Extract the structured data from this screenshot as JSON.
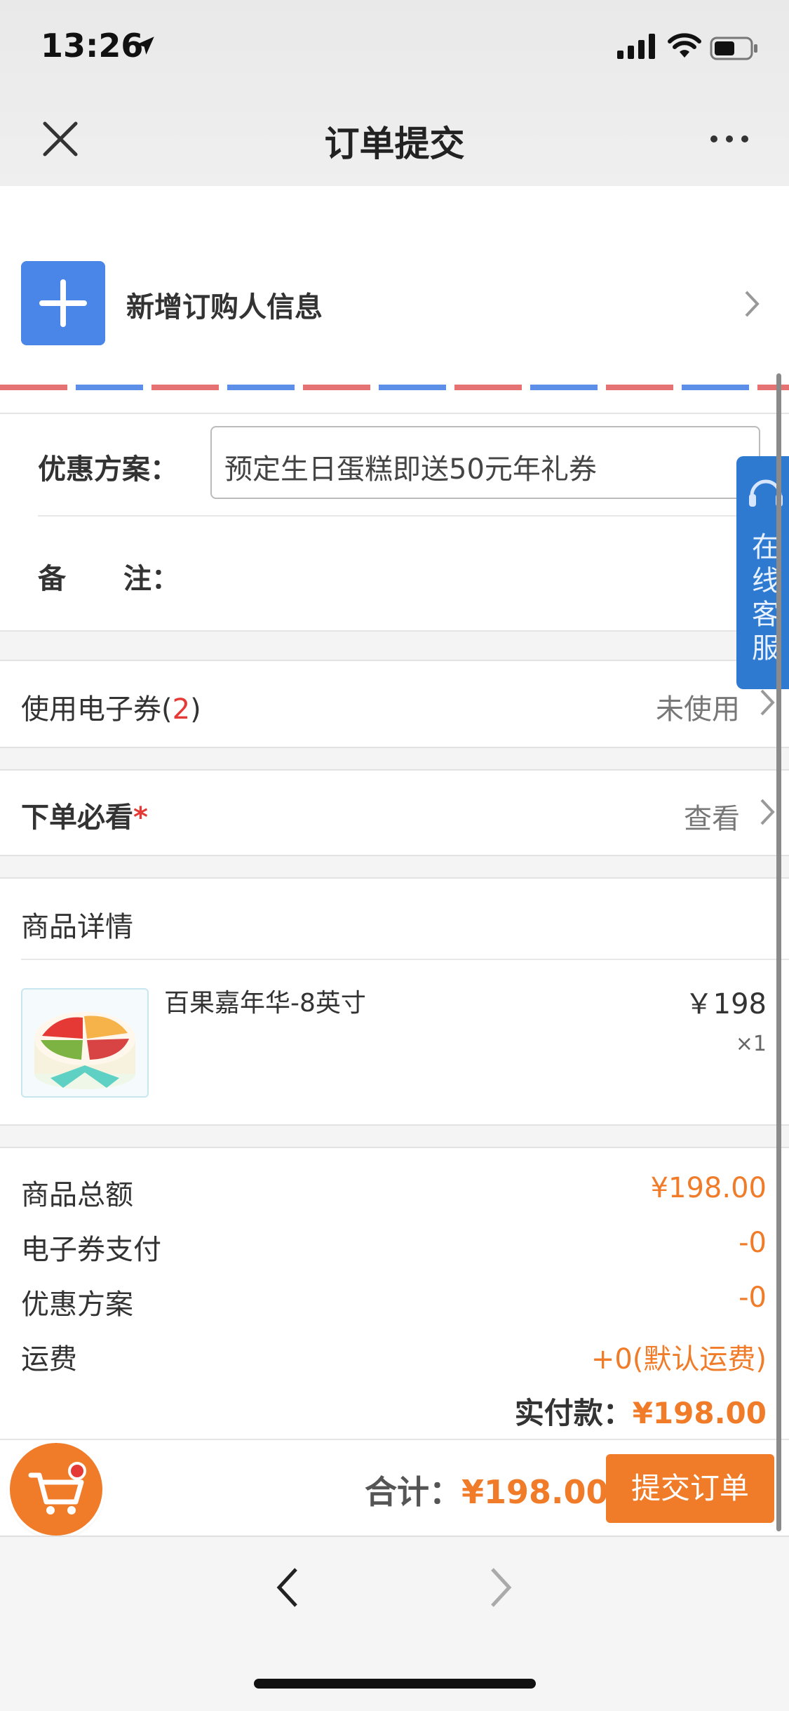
{
  "status_bar": {
    "time": "13:26"
  },
  "nav": {
    "title": "订单提交"
  },
  "buyer": {
    "label": "新增订购人信息"
  },
  "form": {
    "promo_label": "优惠方案：",
    "promo_value": "预定生日蛋糕即送50元年礼券",
    "remark_label_1": "备",
    "remark_label_2": "注：",
    "remark_value": ""
  },
  "coupon": {
    "label": "使用电子券(",
    "count": "2",
    "label_end": ")",
    "value": "未使用"
  },
  "notice": {
    "label": "下单必看",
    "required_mark": "*",
    "value": "查看"
  },
  "product_section": {
    "title": "商品详情",
    "items": [
      {
        "name": "百果嘉年华-8英寸",
        "price": "￥198",
        "qty": "×1"
      }
    ]
  },
  "summary": {
    "rows": [
      {
        "label": "商品总额",
        "value": "¥198.00"
      },
      {
        "label": "电子券支付",
        "value": "-0"
      },
      {
        "label": "优惠方案",
        "value": "-0"
      },
      {
        "label": "运费",
        "value": "+0(默认运费)"
      }
    ],
    "paid_label": "实付款：",
    "paid_value": "¥198.00"
  },
  "bottom_bar": {
    "total_label": "合计：",
    "total_value": "¥198.00",
    "submit_label": "提交订单"
  },
  "service_tab": {
    "label_chars": [
      "在",
      "线",
      "客",
      "服"
    ]
  },
  "colors": {
    "accent": "#f07b28",
    "blue": "#4a86e8",
    "service": "#2e7ad1",
    "required": "#e53935"
  }
}
